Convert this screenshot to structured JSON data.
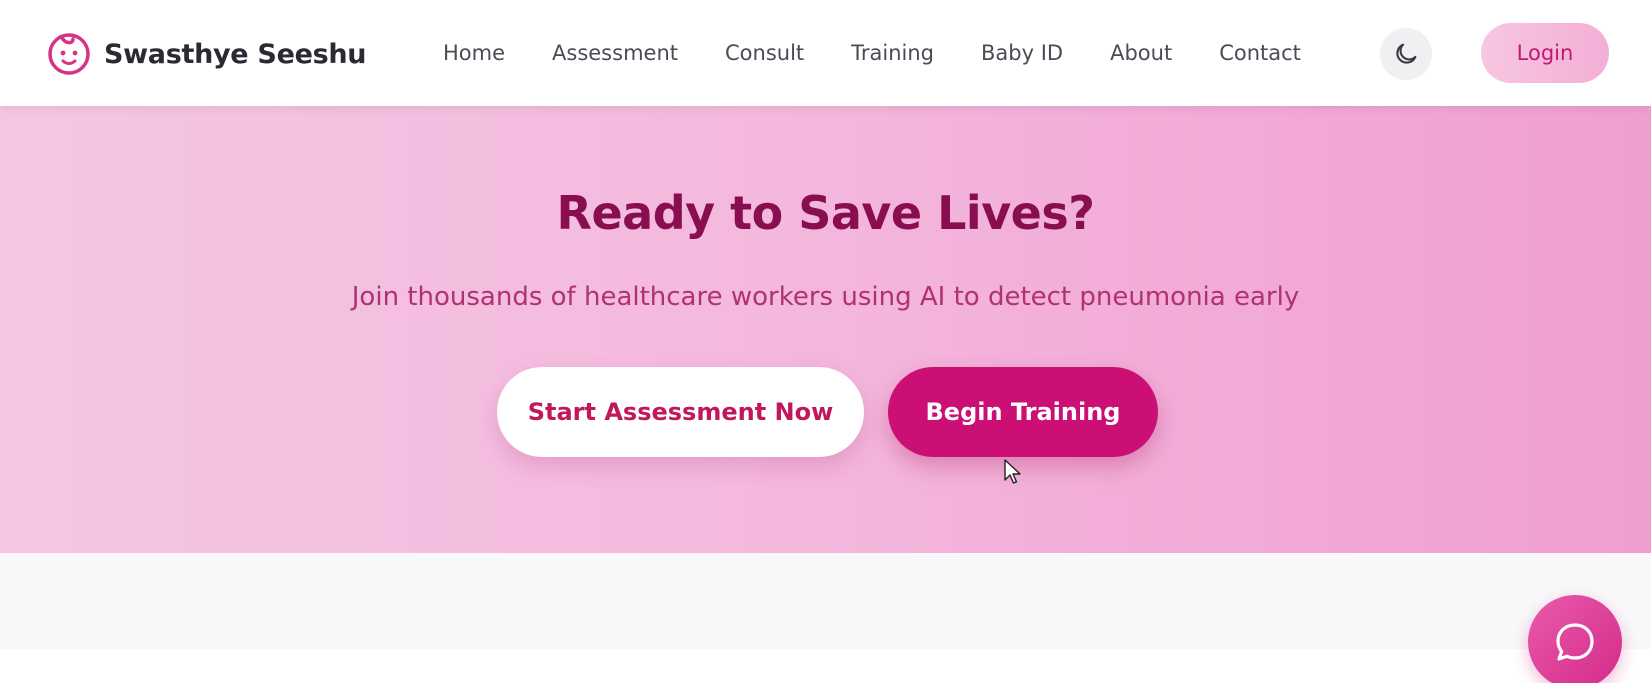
{
  "brand": {
    "name": "Swasthye Seeshu",
    "logo_icon": "baby-face-icon",
    "color": "#d63384"
  },
  "nav": {
    "items": [
      {
        "label": "Home"
      },
      {
        "label": "Assessment"
      },
      {
        "label": "Consult"
      },
      {
        "label": "Training"
      },
      {
        "label": "Baby ID"
      },
      {
        "label": "About"
      },
      {
        "label": "Contact"
      }
    ],
    "theme_toggle_icon": "moon-icon",
    "login_label": "Login"
  },
  "hero": {
    "title": "Ready to Save Lives?",
    "subtitle": "Join thousands of healthcare workers using AI to detect pneumonia early",
    "buttons": {
      "start_assessment": "Start Assessment Now",
      "begin_training": "Begin Training"
    }
  },
  "chat": {
    "icon": "chat-bubble-icon"
  },
  "colors": {
    "accent": "#cc0f75",
    "title": "#880e4f",
    "subtitle": "#b0336f",
    "hero_gradient_start": "#f5c6e3",
    "hero_gradient_end": "#f09ed0"
  }
}
